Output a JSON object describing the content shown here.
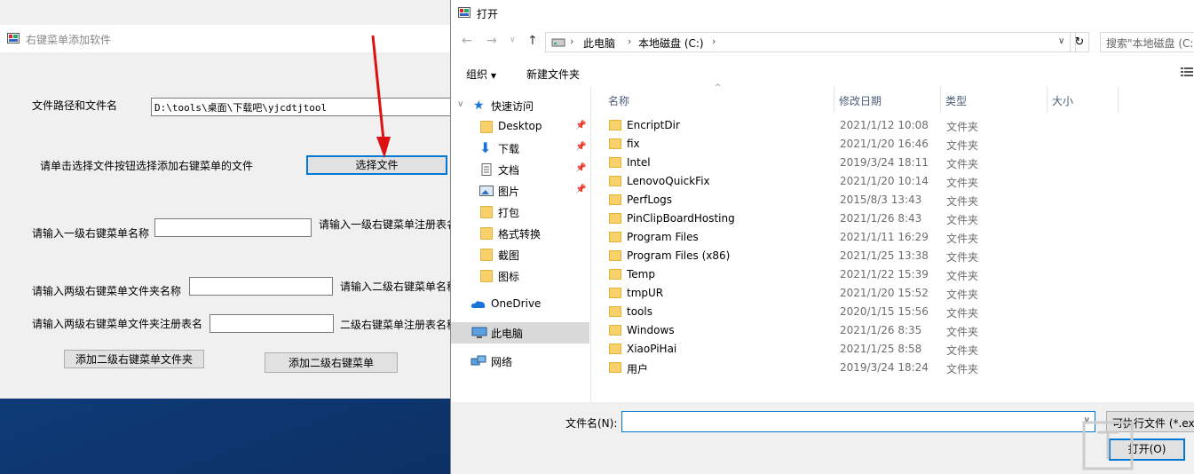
{
  "app": {
    "title": "右键菜单添加软件",
    "path_label": "文件路径和文件名",
    "path_value": "D:\\tools\\桌面\\下载吧\\yjcdtjtool",
    "choose_hint": "请单击选择文件按钮选择添加右键菜单的文件",
    "choose_button": "选择文件",
    "level1_name_label": "请输入一级右键菜单名称",
    "level1_reg_label": "请输入一级右键菜单注册表名",
    "level2_folder_label": "请输入两级右键菜单文件夹名称",
    "level2_name_label": "请输入二级右键菜单名称",
    "level2_reg_label": "请输入两级右键菜单文件夹注册表名",
    "level2_menu_reg_label": "二级右键菜单注册表名称",
    "add_folder_button": "添加二级右键菜单文件夹",
    "add_menu_button": "添加二级右键菜单"
  },
  "dialog": {
    "title": "打开",
    "address": [
      "此电脑",
      "本地磁盘 (C:)"
    ],
    "search_placeholder": "搜索\"本地磁盘 (C:)\"",
    "organize": "组织",
    "new_folder": "新建文件夹",
    "nav": {
      "quick_access": "快速访问",
      "pinned": [
        {
          "label": "Desktop",
          "icon": "folder-icon"
        },
        {
          "label": "下载",
          "icon": "download-icon"
        },
        {
          "label": "文档",
          "icon": "document-icon"
        },
        {
          "label": "图片",
          "icon": "picture-icon"
        }
      ],
      "folders": [
        "打包",
        "格式转换",
        "截图",
        "图标"
      ],
      "onedrive": "OneDrive",
      "this_pc": "此电脑",
      "network": "网络"
    },
    "columns": {
      "name": "名称",
      "modified": "修改日期",
      "type": "类型",
      "size": "大小"
    },
    "files": [
      {
        "name": "EncriptDir",
        "date": "2021/1/12 10:08",
        "type": "文件夹"
      },
      {
        "name": "fix",
        "date": "2021/1/20 16:46",
        "type": "文件夹"
      },
      {
        "name": "Intel",
        "date": "2019/3/24 18:11",
        "type": "文件夹"
      },
      {
        "name": "LenovoQuickFix",
        "date": "2021/1/20 10:14",
        "type": "文件夹"
      },
      {
        "name": "PerfLogs",
        "date": "2015/8/3 13:43",
        "type": "文件夹"
      },
      {
        "name": "PinClipBoardHosting",
        "date": "2021/1/26 8:43",
        "type": "文件夹"
      },
      {
        "name": "Program Files",
        "date": "2021/1/11 16:29",
        "type": "文件夹"
      },
      {
        "name": "Program Files (x86)",
        "date": "2021/1/25 13:38",
        "type": "文件夹"
      },
      {
        "name": "Temp",
        "date": "2021/1/22 15:39",
        "type": "文件夹"
      },
      {
        "name": "tmpUR",
        "date": "2021/1/20 15:52",
        "type": "文件夹"
      },
      {
        "name": "tools",
        "date": "2020/1/15 15:56",
        "type": "文件夹"
      },
      {
        "name": "Windows",
        "date": "2021/1/26 8:35",
        "type": "文件夹"
      },
      {
        "name": "XiaoPiHai",
        "date": "2021/1/25 8:58",
        "type": "文件夹"
      },
      {
        "name": "用户",
        "date": "2019/3/24 18:24",
        "type": "文件夹"
      }
    ],
    "filename_label": "文件名(N):",
    "filename_value": "",
    "filter": "可执行文件 (*.exe)",
    "open_button": "打开(O)"
  }
}
